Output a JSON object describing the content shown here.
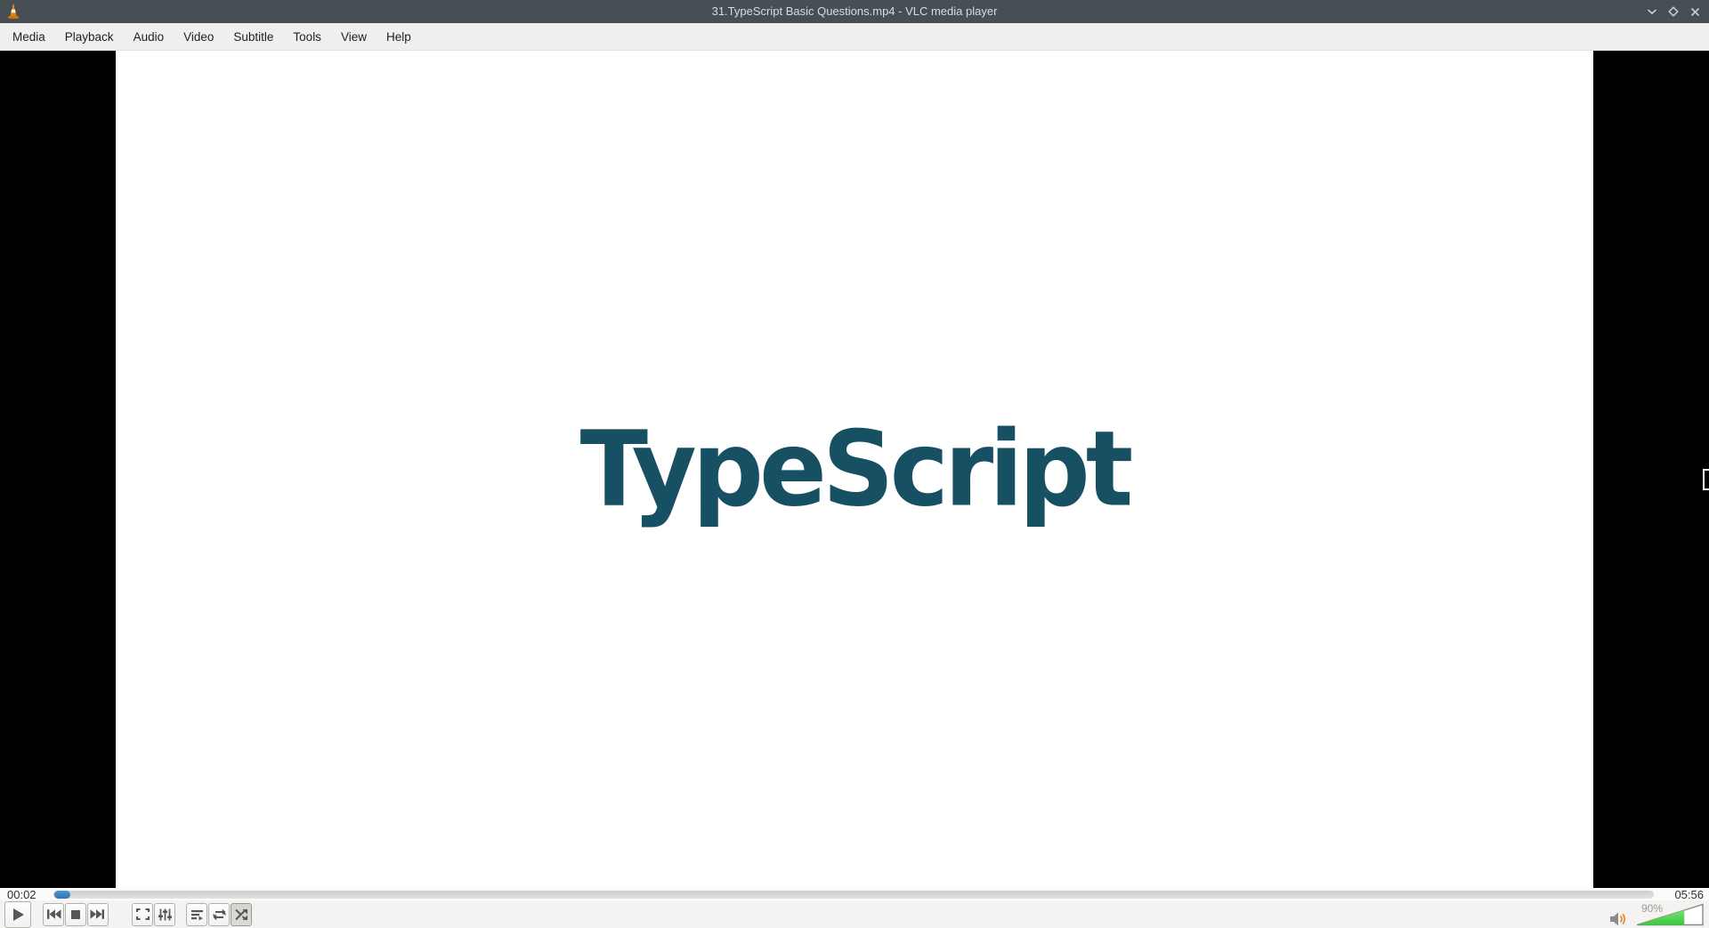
{
  "window": {
    "title": "31.TypeScript Basic Questions.mp4 - VLC media player",
    "app_icon": "vlc-cone-icon",
    "control_icons": [
      "minimize-icon",
      "maximize-icon",
      "close-icon"
    ]
  },
  "menu_bar": {
    "items": [
      "Media",
      "Playback",
      "Audio",
      "Video",
      "Subtitle",
      "Tools",
      "View",
      "Help"
    ]
  },
  "video": {
    "logo_text": "TypeScript",
    "logo_color": "#175063",
    "frame_background": "#ffffff",
    "pillarbox_color": "#000000"
  },
  "seek": {
    "elapsed": "00:02",
    "total": "05:56",
    "progress_fraction": 0.01,
    "progress_color": "#3584c6"
  },
  "controls": {
    "button_icons": [
      "play-icon",
      "previous-icon",
      "stop-icon",
      "next-icon",
      "fullscreen-icon",
      "equalizer-icon",
      "playlist-icon",
      "loop-icon",
      "shuffle-icon"
    ],
    "shuffle_pressed": true
  },
  "volume": {
    "label": "90%",
    "slider_fill_fraction": 0.72,
    "fill_color": "#3ecf3e",
    "icon": "speaker-icon"
  },
  "colors": {
    "titlebar": "#474e54",
    "menubar": "#f0efed",
    "toolbar": "#f4f3f1"
  }
}
